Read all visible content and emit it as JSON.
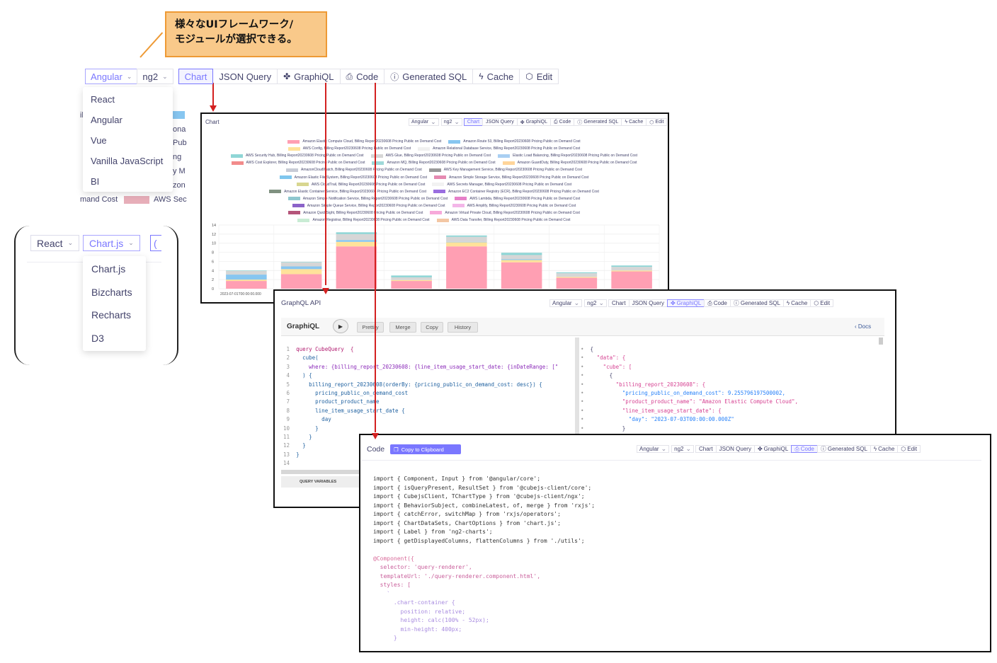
{
  "callout": {
    "line1": "様々なUIフレームワーク/",
    "line2": "モジュールが選択できる。"
  },
  "toolbar": {
    "framework": "Angular",
    "library": "ng2",
    "buttons": [
      {
        "label": "Chart",
        "icon": "none",
        "active": true
      },
      {
        "label": "JSON Query",
        "icon": "none",
        "active": false
      },
      {
        "label": "GraphiQL",
        "icon": "graphql-icon",
        "active": false
      },
      {
        "label": "Code",
        "icon": "terminal-icon",
        "active": false
      },
      {
        "label": "Generated SQL",
        "icon": "question-circle-icon",
        "active": false
      },
      {
        "label": "Cache",
        "icon": "lightning-icon",
        "active": false
      },
      {
        "label": "Edit",
        "icon": "cube-icon",
        "active": false
      }
    ]
  },
  "framework_dropdown": {
    "options": [
      "React",
      "Angular",
      "Vue",
      "Vanilla JavaScript",
      "BI"
    ]
  },
  "bg_fragments": [
    "il",
    "ona",
    "Pub",
    "ng",
    "y M",
    "zon",
    "mand Cost",
    "AWS Sec"
  ],
  "bracket": {
    "framework": "React",
    "library": "Chart.js",
    "options": [
      "Chart.js",
      "Bizcharts",
      "Recharts",
      "D3"
    ]
  },
  "chart_panel": {
    "title": "Chart",
    "toolbar": {
      "framework": "Angular",
      "library": "ng2",
      "buttons": [
        "Chart",
        "JSON Query",
        "GraphiQL",
        "Code",
        "Generated SQL",
        "Cache",
        "Edit"
      ]
    },
    "legend_rows": [
      [
        {
          "label": "Amazon Elastic Compute Cloud, Billing Report20230608 Pricing Public on Demand Cost",
          "color": "#ff9fb3"
        },
        {
          "label": "Amazon Route 53, Billing Report20230608 Pricing Public on Demand Cost",
          "color": "#87c6f0"
        }
      ],
      [
        {
          "label": "AWS Config, Billing Report20230608 Pricing Public on Demand Cost",
          "color": "#ffe29a"
        },
        {
          "label": "Amazon Relational Database Service, Billing Report20230608 Pricing Public on Demand Cost",
          "color": "#f0f0f0"
        }
      ],
      [
        {
          "label": "AWS Security Hub, Billing Report20230608 Pricing Public on Demand Cost",
          "color": "#8fd6d6"
        },
        {
          "label": "AWS Glue, Billing Report20230608 Pricing Public on Demand Cost",
          "color": "#d6d6d6"
        },
        {
          "label": "Elastic Load Balancing, Billing Report20230608 Pricing Public on Demand Cost",
          "color": "#a9cff2"
        }
      ],
      [
        {
          "label": "AWS Cost Explorer, Billing Report20230608 Pricing Public on Demand Cost",
          "color": "#f28b8b"
        },
        {
          "label": "Amazon MQ, Billing Report20230608 Pricing Public on Demand Cost",
          "color": "#9fd9d9"
        },
        {
          "label": "Amazon GuardDuty, Billing Report20230608 Pricing Public on Demand Cost",
          "color": "#ffd59a"
        }
      ],
      [
        {
          "label": "AmazonCloudWatch, Billing Report20230608 Pricing Public on Demand Cost",
          "color": "#c8cbd6"
        },
        {
          "label": "AWS Key Management Service, Billing Report20230608 Pricing Public on Demand Cost",
          "color": "#9a9a9a"
        }
      ],
      [
        {
          "label": "Amazon Elastic File System, Billing Report20230608 Pricing Public on Demand Cost",
          "color": "#7fc6ee"
        },
        {
          "label": "Amazon Simple Storage Service, Billing Report20230608 Pricing Public on Demand Cost",
          "color": "#e58ab1"
        }
      ],
      [
        {
          "label": "AWS CloudTrail, Billing Report20230608 Pricing Public on Demand Cost",
          "color": "#d8d690"
        },
        {
          "label": "AWS Secrets Manager, Billing Report20230608 Pricing Public on Demand Cost",
          "color": "#f2f2f2"
        }
      ],
      [
        {
          "label": "Amazon Elastic Container Service, Billing Report20230608 Pricing Public on Demand Cost",
          "color": "#7f9180"
        },
        {
          "label": "Amazon EC2 Container Registry (ECR), Billing Report20230608 Pricing Public on Demand Cost",
          "color": "#9a6ee0"
        }
      ],
      [
        {
          "label": "Amazon Simple Notification Service, Billing Report20230608 Pricing Public on Demand Cost",
          "color": "#8fc7cf"
        },
        {
          "label": "AWS Lambda, Billing Report20230608 Pricing Public on Demand Cost",
          "color": "#e680c9"
        }
      ],
      [
        {
          "label": "Amazon Simple Queue Service, Billing Report20230608 Pricing Public on Demand Cost",
          "color": "#8b63c9"
        },
        {
          "label": "AWS Amplify, Billing Report20230608 Pricing Public on Demand Cost",
          "color": "#f3b6e8"
        }
      ],
      [
        {
          "label": "Amazon QuickSight, Billing Report20230608 Pricing Public on Demand Cost",
          "color": "#b5557a"
        },
        {
          "label": "Amazon Virtual Private Cloud, Billing Report20230608 Pricing Public on Demand Cost",
          "color": "#f7a9da"
        }
      ],
      [
        {
          "label": "Amazon Registrar, Billing Report20230608 Pricing Public on Demand Cost",
          "color": "#c9ecd4"
        },
        {
          "label": "AWS Data Transfer, Billing Report20230608 Pricing Public on Demand Cost",
          "color": "#f3c7a4"
        }
      ]
    ]
  },
  "chart_data": {
    "type": "bar",
    "stacked": true,
    "ylim": [
      0,
      14
    ],
    "yticks": [
      0,
      2,
      4,
      6,
      8,
      10,
      12,
      14
    ],
    "categories": [
      "2023-07-01T00:00:00.000",
      "",
      "",
      "",
      "",
      "",
      "",
      ""
    ],
    "series": [
      {
        "name": "Amazon Elastic Compute Cloud, Billing Report20230608 Pricing Public on Demand Cost",
        "color": "#ff9fb3",
        "values": [
          1.7,
          3.2,
          9.3,
          1.7,
          9.3,
          5.8,
          2.4,
          3.8
        ]
      },
      {
        "name": "AWS Config, Billing Report20230608 Pricing Public on Demand Cost",
        "color": "#ffe29a",
        "values": [
          0.3,
          1.1,
          1.0,
          0.2,
          0.9,
          0.5,
          0.2,
          0.2
        ]
      },
      {
        "name": "Amazon Route 53, Billing Report20230608 Pricing Public on Demand Cost",
        "color": "#87c6f0",
        "values": [
          1.1,
          0.6,
          0.4,
          0.0,
          0.1,
          0.2,
          0.0,
          0.0
        ]
      },
      {
        "name": "AWS Glue, Billing Report20230608 Pricing Public on Demand Cost",
        "color": "#d6d6d6",
        "values": [
          0.8,
          0.9,
          1.3,
          0.6,
          1.1,
          0.9,
          0.8,
          0.8
        ]
      },
      {
        "name": "AWS Security Hub, Billing Report20230608 Pricing Public on Demand Cost",
        "color": "#8fd6d6",
        "values": [
          0.1,
          0.1,
          0.4,
          0.4,
          0.3,
          0.5,
          0.2,
          0.3
        ]
      }
    ]
  },
  "graphql_panel": {
    "title": "GraphQL API",
    "logo": "GraphiQL",
    "buttons": [
      "Prettify",
      "Merge",
      "Copy",
      "History"
    ],
    "docs": "Docs",
    "toolbar": {
      "framework": "Angular",
      "library": "ng2",
      "buttons": [
        "Chart",
        "JSON Query",
        "GraphiQL",
        "Code",
        "Generated SQL",
        "Cache",
        "Edit"
      ]
    },
    "query_lines": [
      "query CubeQuery  {",
      "  cube(",
      "    where: {billing_report_20230608: {line_item_usage_start_date: {inDateRange: [\"",
      "  ) {",
      "    billing_report_20230608(orderBy: {pricing_public_on_demand_cost: desc}) {",
      "      pricing_public_on_demand_cost",
      "      product_product_name",
      "      line_item_usage_start_date {",
      "        day",
      "      }",
      "    }",
      "  }",
      "}",
      ""
    ],
    "result_lines": [
      "{",
      "  \"data\": {",
      "    \"cube\": [",
      "      {",
      "        \"billing_report_20230608\": {",
      "          \"pricing_public_on_demand_cost\": 9.255796197500002,",
      "          \"product_product_name\": \"Amazon Elastic Compute Cloud\",",
      "          \"line_item_usage_start_date\": {",
      "            \"day\": \"2023-07-03T00:00:00.000Z\"",
      "          }"
    ],
    "variables_label": "QUERY VARIABLES"
  },
  "code_panel": {
    "title": "Code",
    "copy_label": "Copy to Clipboard",
    "toolbar": {
      "framework": "Angular",
      "library": "ng2",
      "buttons": [
        "Chart",
        "JSON Query",
        "GraphiQL",
        "Code",
        "Generated SQL",
        "Cache",
        "Edit"
      ]
    },
    "lines": [
      "import { Component, Input } from '@angular/core';",
      "import { isQueryPresent, ResultSet } from '@cubejs-client/core';",
      "import { CubejsClient, TChartType } from '@cubejs-client/ngx';",
      "import { BehaviorSubject, combineLatest, of, merge } from 'rxjs';",
      "import { catchError, switchMap } from 'rxjs/operators';",
      "import { ChartDataSets, ChartOptions } from 'chart.js';",
      "import { Label } from 'ng2-charts';",
      "import { getDisplayedColumns, flattenColumns } from './utils';",
      "",
      "@Component({",
      "  selector: 'query-renderer',",
      "  templateUrl: './query-renderer.component.html',",
      "  styles: [",
      "    `",
      "      .chart-container {",
      "        position: relative;",
      "        height: calc(100% - 52px);",
      "        min-height: 400px;",
      "      }"
    ]
  }
}
